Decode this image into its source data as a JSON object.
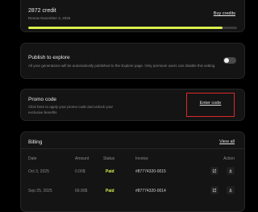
{
  "credits": {
    "amount": "2872 credit",
    "renew_text": "Renew November 3, 2025",
    "buy_label": "Buy credits",
    "progress_fraction": 0.93,
    "accent_color": "#d8f04c"
  },
  "publish": {
    "title": "Publish to explore",
    "description": "All your generations will be automatically published to the Explore page. Only premium users can disable this setting",
    "toggle_on": false
  },
  "promo": {
    "title": "Promo code",
    "description": "Click here to apply your promo code and unlock your exclusive benefits",
    "enter_label": "Enter code"
  },
  "billing": {
    "title": "Billing",
    "view_all_label": "View all",
    "columns": [
      "Date",
      "Amount",
      "Status",
      "Invoice",
      "Action"
    ],
    "rows": [
      {
        "date": "Oct 3, 2025",
        "amount": "0.00$",
        "status": "Paid",
        "invoice": "#87774320-0015"
      },
      {
        "date": "Sep 25, 2025",
        "amount": "69.90$",
        "status": "Paid",
        "invoice": "#87774320-0014"
      }
    ],
    "action_icons": [
      "external-link-icon",
      "download-icon"
    ]
  }
}
